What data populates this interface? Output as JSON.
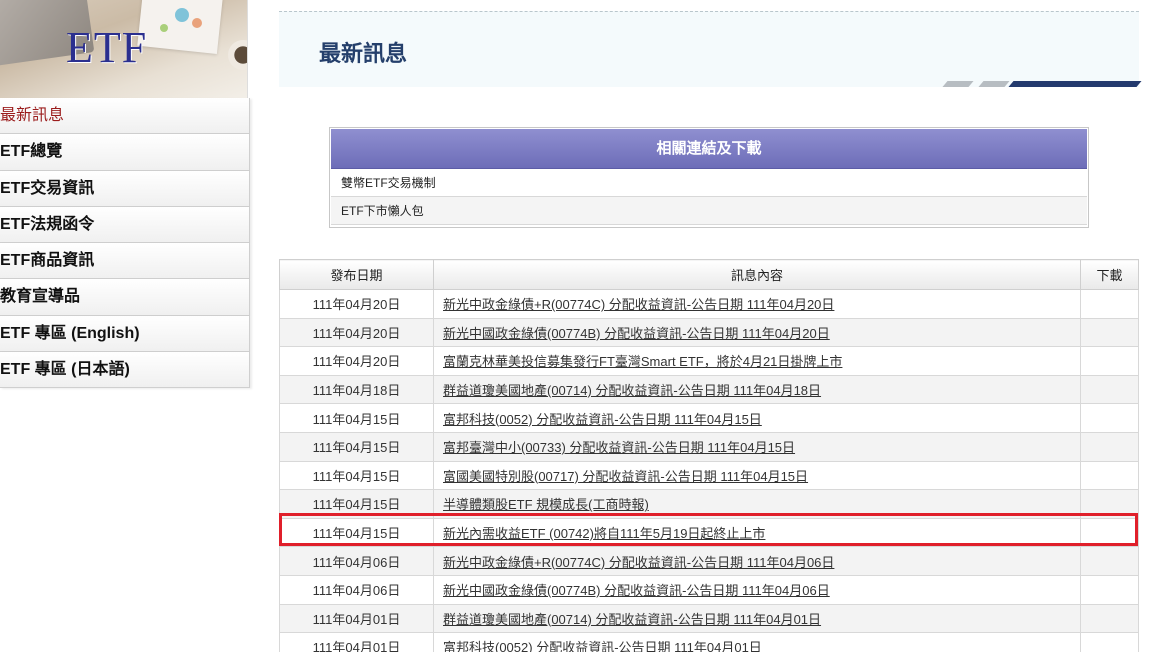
{
  "sidebar": {
    "logo_text": "ETF",
    "items": [
      {
        "label": "最新訊息",
        "active": true
      },
      {
        "label": "ETF總覽"
      },
      {
        "label": "ETF交易資訊"
      },
      {
        "label": "ETF法規函令"
      },
      {
        "label": "ETF商品資訊"
      },
      {
        "label": "教育宣導品"
      },
      {
        "label": "ETF 專區 (English)"
      },
      {
        "label": "ETF 專區 (日本語)"
      }
    ]
  },
  "header": {
    "title": "最新訊息"
  },
  "links": {
    "heading": "相關連結及下載",
    "items": [
      "雙幣ETF交易機制",
      "ETF下市懶人包"
    ]
  },
  "news": {
    "columns": [
      "發布日期",
      "訊息內容",
      "下載"
    ],
    "rows": [
      {
        "date": "111年04月20日",
        "text": "新光中政金綠債+R(00774C) 分配收益資訊-公告日期 111年04月20日"
      },
      {
        "date": "111年04月20日",
        "text": "新光中國政金綠債(00774B) 分配收益資訊-公告日期 111年04月20日"
      },
      {
        "date": "111年04月20日",
        "text": "富蘭克林華美投信募集發行FT臺灣Smart ETF，將於4月21日掛牌上市"
      },
      {
        "date": "111年04月18日",
        "text": "群益道瓊美國地產(00714) 分配收益資訊-公告日期 111年04月18日"
      },
      {
        "date": "111年04月15日",
        "text": "富邦科技(0052) 分配收益資訊-公告日期 111年04月15日"
      },
      {
        "date": "111年04月15日",
        "text": "富邦臺灣中小(00733) 分配收益資訊-公告日期 111年04月15日"
      },
      {
        "date": "111年04月15日",
        "text": "富國美國特別股(00717) 分配收益資訊-公告日期 111年04月15日"
      },
      {
        "date": "111年04月15日",
        "text": "半導體類股ETF 規模成長(工商時報)"
      },
      {
        "date": "111年04月15日",
        "text": "新光內需收益ETF (00742)將自111年5月19日起終止上市"
      },
      {
        "date": "111年04月06日",
        "text": "新光中政金綠債+R(00774C) 分配收益資訊-公告日期 111年04月06日"
      },
      {
        "date": "111年04月06日",
        "text": "新光中國政金綠債(00774B) 分配收益資訊-公告日期 111年04月06日"
      },
      {
        "date": "111年04月01日",
        "text": "群益道瓊美國地產(00714) 分配收益資訊-公告日期 111年04月01日"
      },
      {
        "date": "111年04月01日",
        "text": "富邦科技(0052) 分配收益資訊-公告日期 111年04月01日"
      }
    ]
  },
  "colors": {
    "accent": "#e01f2a",
    "link_header": "#7b7bc4",
    "title": "#243f6b",
    "active_menu": "#9b1c1c"
  }
}
